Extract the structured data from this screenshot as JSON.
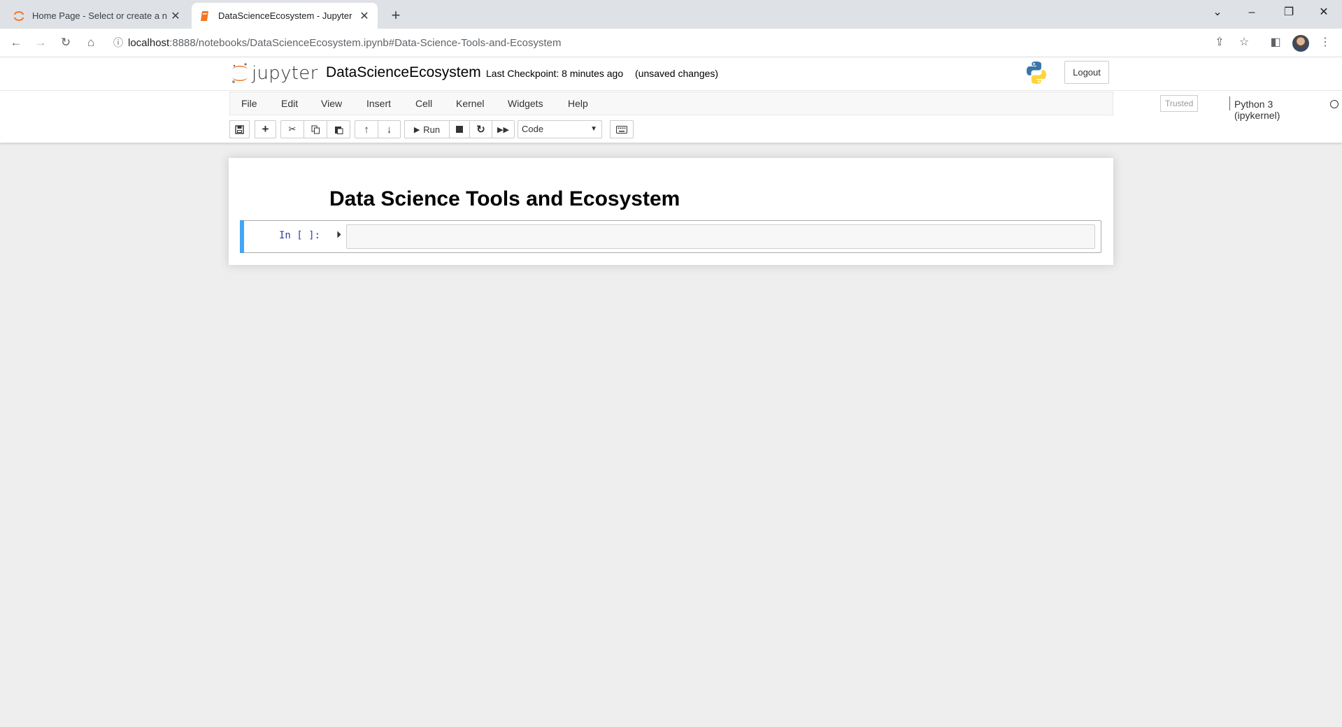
{
  "browser": {
    "tabs": [
      {
        "title": "Home Page - Select or create a n",
        "active": false
      },
      {
        "title": "DataScienceEcosystem - Jupyter",
        "active": true
      }
    ],
    "new_tab": "+",
    "url_host": "localhost",
    "url_path": ":8888/notebooks/DataScienceEcosystem.ipynb#Data-Science-Tools-and-Ecosystem"
  },
  "header": {
    "logo_text": "jupyter",
    "notebook_name": "DataScienceEcosystem",
    "checkpoint": "Last Checkpoint: 8 minutes ago",
    "unsaved": "(unsaved changes)",
    "logout_label": "Logout"
  },
  "menubar": {
    "items": [
      "File",
      "Edit",
      "View",
      "Insert",
      "Cell",
      "Kernel",
      "Widgets",
      "Help"
    ],
    "trusted": "Trusted",
    "kernel": "Python 3 (ipykernel)"
  },
  "toolbar": {
    "run_label": "Run",
    "cell_type": "Code"
  },
  "notebook": {
    "heading": "Data Science Tools and Ecosystem",
    "prompt": "In [ ]:"
  },
  "colors": {
    "jupyter_orange": "#f37626",
    "cell_selected": "#42a5f5",
    "prompt_blue": "#303f9f"
  }
}
